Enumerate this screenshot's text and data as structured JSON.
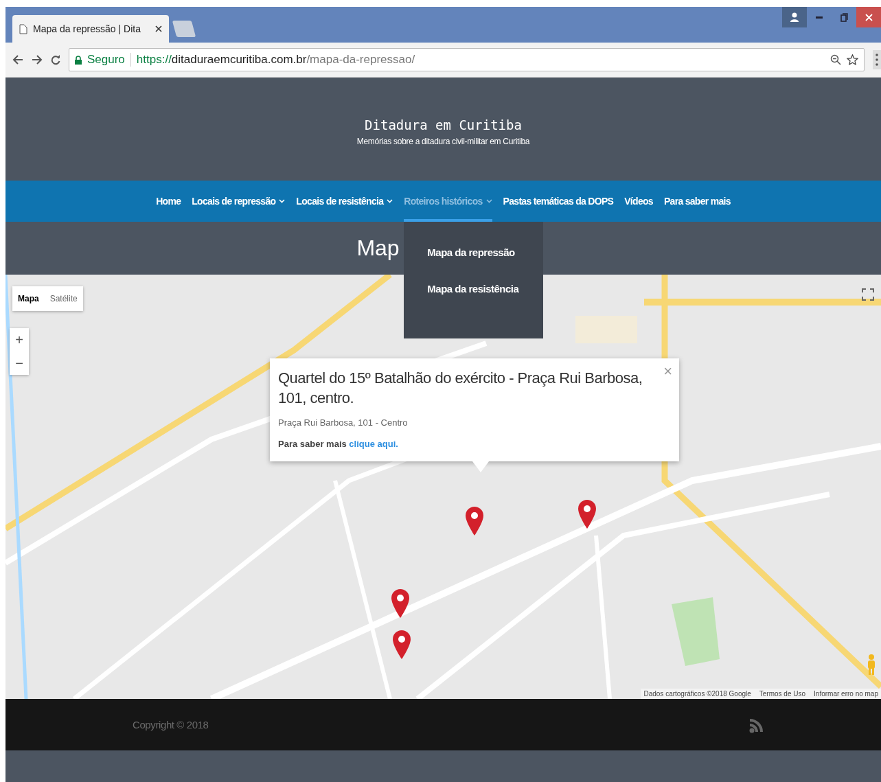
{
  "browser": {
    "tab": {
      "title": "Mapa da repressão | Dita"
    },
    "address": {
      "secure_label": "Seguro",
      "scheme": "https://",
      "host": "ditaduraemcuritiba.com.br",
      "path": "/mapa-da-repressao/"
    }
  },
  "site": {
    "title": "Ditadura em Curitiba",
    "subtitle": "Memórias sobre a ditadura civil-militar em Curitiba"
  },
  "nav": [
    {
      "label": "Home",
      "dropdown": false,
      "selected": false
    },
    {
      "label": "Locais de repressão",
      "dropdown": true,
      "selected": false
    },
    {
      "label": "Locais de resistência",
      "dropdown": true,
      "selected": false
    },
    {
      "label": "Roteiros históricos",
      "dropdown": true,
      "selected": true
    },
    {
      "label": "Pastas temáticas da DOPS",
      "dropdown": false,
      "selected": false
    },
    {
      "label": "Vídeos",
      "dropdown": false,
      "selected": false
    },
    {
      "label": "Para saber mais",
      "dropdown": false,
      "selected": false
    }
  ],
  "dropdown": [
    "Mapa da repressão",
    "Mapa da resistência"
  ],
  "page_title": "Map",
  "map": {
    "map_types": [
      {
        "label": "Mapa",
        "selected": true
      },
      {
        "label": "Satélite",
        "selected": false
      }
    ],
    "zoom": [
      "+",
      "−"
    ],
    "popup": {
      "close": "×",
      "title": "Quartel do 15º Batalhão do exército - Praça Rui Barbosa, 101, centro.",
      "address": "Praça Rui Barbosa, 101 - Centro",
      "more_text": "Para saber mais",
      "link": "clique aqui."
    },
    "attribution": [
      "Dados cartográficos ©2018 Google",
      "Termos de Uso",
      "Informar erro no map"
    ]
  },
  "footer": {
    "copyright": "Copyright © 2018"
  }
}
